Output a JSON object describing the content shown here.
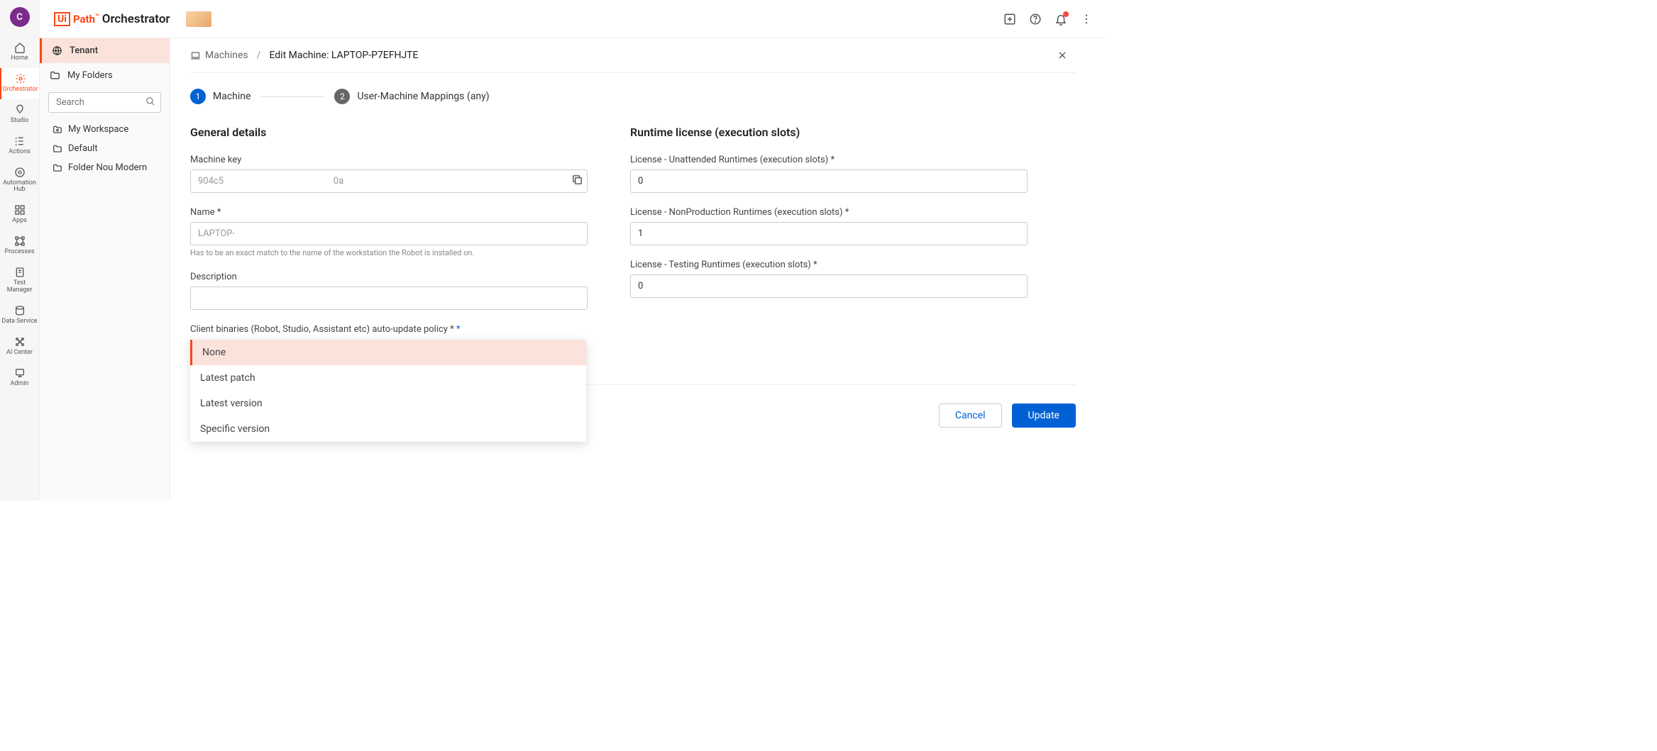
{
  "topbar": {
    "avatar_letter": "C",
    "brand_orchestrator": "Orchestrator"
  },
  "rail": [
    {
      "id": "home",
      "label": "Home"
    },
    {
      "id": "orchestrator",
      "label": "Orchestrator"
    },
    {
      "id": "studio",
      "label": "Studio"
    },
    {
      "id": "actions",
      "label": "Actions"
    },
    {
      "id": "automation-hub",
      "label": "Automation Hub"
    },
    {
      "id": "apps",
      "label": "Apps"
    },
    {
      "id": "processes",
      "label": "Processes"
    },
    {
      "id": "test-manager",
      "label": "Test Manager"
    },
    {
      "id": "data-service",
      "label": "Data Service"
    },
    {
      "id": "ai-center",
      "label": "AI Center"
    },
    {
      "id": "admin",
      "label": "Admin"
    }
  ],
  "sidepanel": {
    "tenant": "Tenant",
    "my_folders": "My Folders",
    "search_placeholder": "Search",
    "folders": [
      {
        "name": "My Workspace"
      },
      {
        "name": "Default"
      },
      {
        "name": "Folder Nou Modern"
      }
    ]
  },
  "crumbs": {
    "machines": "Machines",
    "edit": "Edit Machine: LAPTOP-P7EFHJTE"
  },
  "stepper": {
    "step1": "Machine",
    "step2": "User-Machine Mappings (any)"
  },
  "form": {
    "general_h": "General details",
    "runtime_h": "Runtime license (execution slots)",
    "machine_key_label": "Machine key",
    "machine_key_value": "904c5                                                0a",
    "name_label": "Name *",
    "name_value": "LAPTOP-",
    "name_hint": "Has to be an exact match to the name of the workstation the Robot is installed on.",
    "description_label": "Description",
    "description_value": "",
    "policy_label": "Client binaries (Robot, Studio, Assistant etc) auto-update policy *",
    "lic_unattended_label": "License - Unattended Runtimes (execution slots) *",
    "lic_unattended_value": "0",
    "lic_nonprod_label": "License - NonProduction Runtimes (execution slots) *",
    "lic_nonprod_value": "1",
    "lic_testing_label": "License - Testing Runtimes (execution slots) *",
    "lic_testing_value": "0"
  },
  "dropdown": {
    "options": [
      "None",
      "Latest patch",
      "Latest version",
      "Specific version"
    ],
    "selected": "None"
  },
  "buttons": {
    "cancel": "Cancel",
    "update": "Update"
  }
}
